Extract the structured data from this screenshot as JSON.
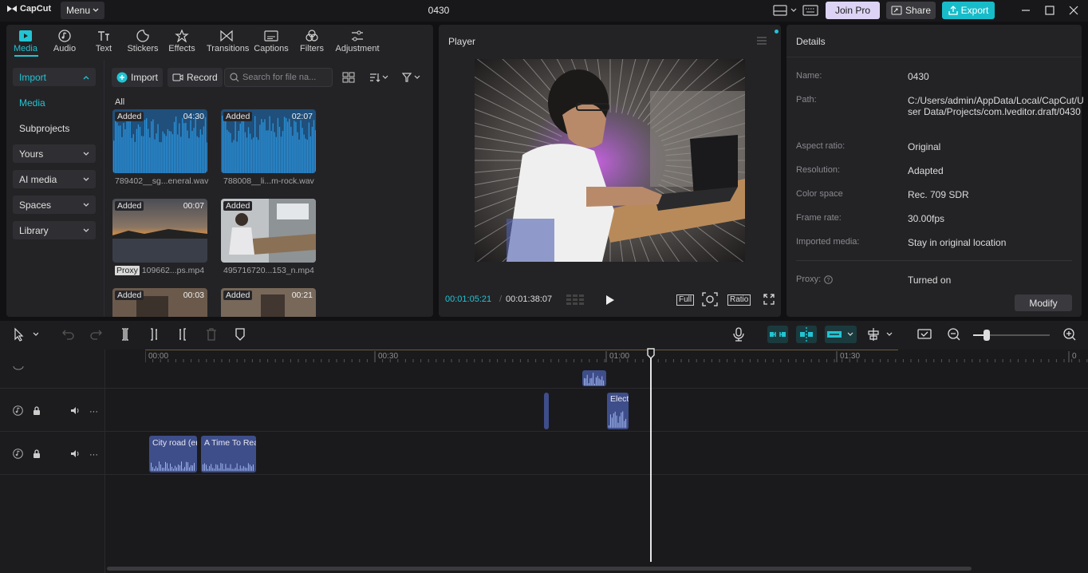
{
  "app": {
    "logo_text": "CapCut",
    "menu_label": "Menu",
    "project_title": "0430"
  },
  "topbar": {
    "join_pro": "Join Pro",
    "share": "Share",
    "export": "Export"
  },
  "tabs": [
    {
      "label": "Media",
      "icon": "media-icon"
    },
    {
      "label": "Audio",
      "icon": "audio-icon"
    },
    {
      "label": "Text",
      "icon": "text-icon"
    },
    {
      "label": "Stickers",
      "icon": "stickers-icon"
    },
    {
      "label": "Effects",
      "icon": "effects-icon"
    },
    {
      "label": "Transitions",
      "icon": "transitions-icon"
    },
    {
      "label": "Captions",
      "icon": "captions-icon"
    },
    {
      "label": "Filters",
      "icon": "filters-icon"
    },
    {
      "label": "Adjustment",
      "icon": "adjustment-icon"
    }
  ],
  "sidebar": {
    "items": [
      {
        "label": "Import"
      },
      {
        "label": "Media"
      },
      {
        "label": "Subprojects"
      },
      {
        "label": "Yours"
      },
      {
        "label": "AI media"
      },
      {
        "label": "Spaces"
      },
      {
        "label": "Library"
      }
    ]
  },
  "media_toolbar": {
    "import": "Import",
    "record": "Record",
    "search_placeholder": "Search for file na..."
  },
  "media": {
    "filter_label": "All",
    "items": [
      {
        "badge": "Added",
        "duration": "04:30",
        "name": "789402__sg...eneral.wav",
        "type": "audio"
      },
      {
        "badge": "Added",
        "duration": "02:07",
        "name": "788008__li...m-rock.wav",
        "type": "audio"
      },
      {
        "badge": "Added",
        "duration": "00:07",
        "name": "109662...ps.mp4",
        "proxy": "Proxy",
        "type": "video"
      },
      {
        "badge": "Added",
        "duration": "",
        "name": "495716720...153_n.mp4",
        "type": "video"
      },
      {
        "badge": "Added",
        "duration": "00:03",
        "name": "",
        "type": "video"
      },
      {
        "badge": "Added",
        "duration": "00:21",
        "name": "",
        "type": "video"
      }
    ]
  },
  "player": {
    "title": "Player",
    "current_time": "00:01:05:21",
    "total_time": "00:01:38:07",
    "full": "Full",
    "ratio": "Ratio"
  },
  "details": {
    "title": "Details",
    "rows": [
      {
        "label": "Name:",
        "value": "0430"
      },
      {
        "label": "Path:",
        "value": "C:/Users/admin/AppData/Local/CapCut/User Data/Projects/com.lveditor.draft/0430"
      },
      {
        "label": "Aspect ratio:",
        "value": "Original"
      },
      {
        "label": "Resolution:",
        "value": "Adapted"
      },
      {
        "label": "Color space",
        "value": "Rec. 709 SDR"
      },
      {
        "label": "Frame rate:",
        "value": "30.00fps"
      },
      {
        "label": "Imported media:",
        "value": "Stay in original location"
      },
      {
        "label": "Proxy:",
        "value": "Turned on"
      }
    ],
    "modify": "Modify"
  },
  "timeline": {
    "ticks": [
      "00:00",
      "00:30",
      "01:00",
      "01:30",
      "0"
    ],
    "clips": [
      {
        "label": "Elect"
      },
      {
        "label": "City road (er"
      },
      {
        "label": "A Time To Rea"
      }
    ]
  },
  "colors": {
    "accent": "#22c4d3",
    "clip": "#3e4e8a",
    "panel": "#232326"
  }
}
